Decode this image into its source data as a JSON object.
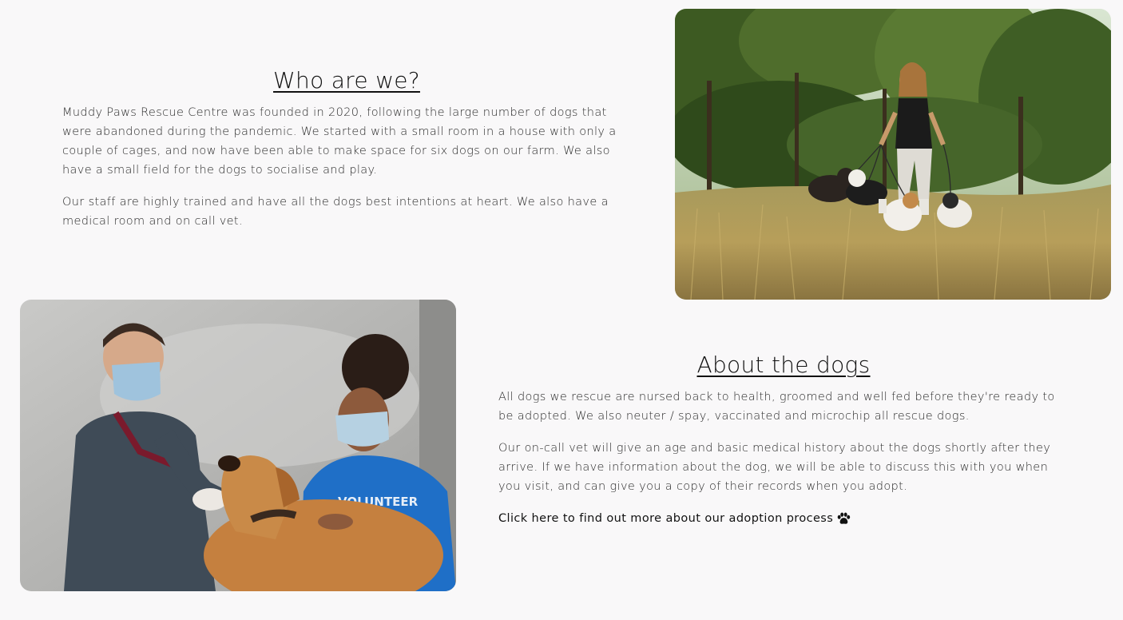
{
  "who_section": {
    "title": "Who are we?",
    "paragraphs": [
      "Muddy Paws Rescue Centre was founded in 2020, following the large number of dogs that were abandoned during the pandemic. We started with a small room in a house with only a couple of cages, and now have been able to make space for six dogs on our farm. We also have a small field for the dogs to socialise and play.",
      "Our staff are highly trained and have all the dogs best intentions at heart. We also have a medical room and on call vet."
    ]
  },
  "about_section": {
    "title": "About the dogs",
    "paragraphs": [
      "All dogs we rescue are nursed back to health, groomed and well fed before they're ready to be adopted. We also neuter / spay, vaccinated and microchip all rescue dogs.",
      "Our on-call vet will give an age and basic medical history about the dogs shortly after they arrive. If we have information about the dog, we will be able to discuss this with you when you visit, and can give you a copy of their records when you adopt."
    ],
    "link_text": "Click here to find out more about our adoption process",
    "link_icon": "paw-icon"
  },
  "images": {
    "walk_photo_icon": "woman-walking-dogs-photo",
    "vet_photo_icon": "vet-and-volunteer-with-dog-photo",
    "volunteer_shirt_text": "VOLUNTEER"
  },
  "colors": {
    "background": "#f9f8f9",
    "text": "#2b2b2b",
    "heading": "#111111"
  }
}
